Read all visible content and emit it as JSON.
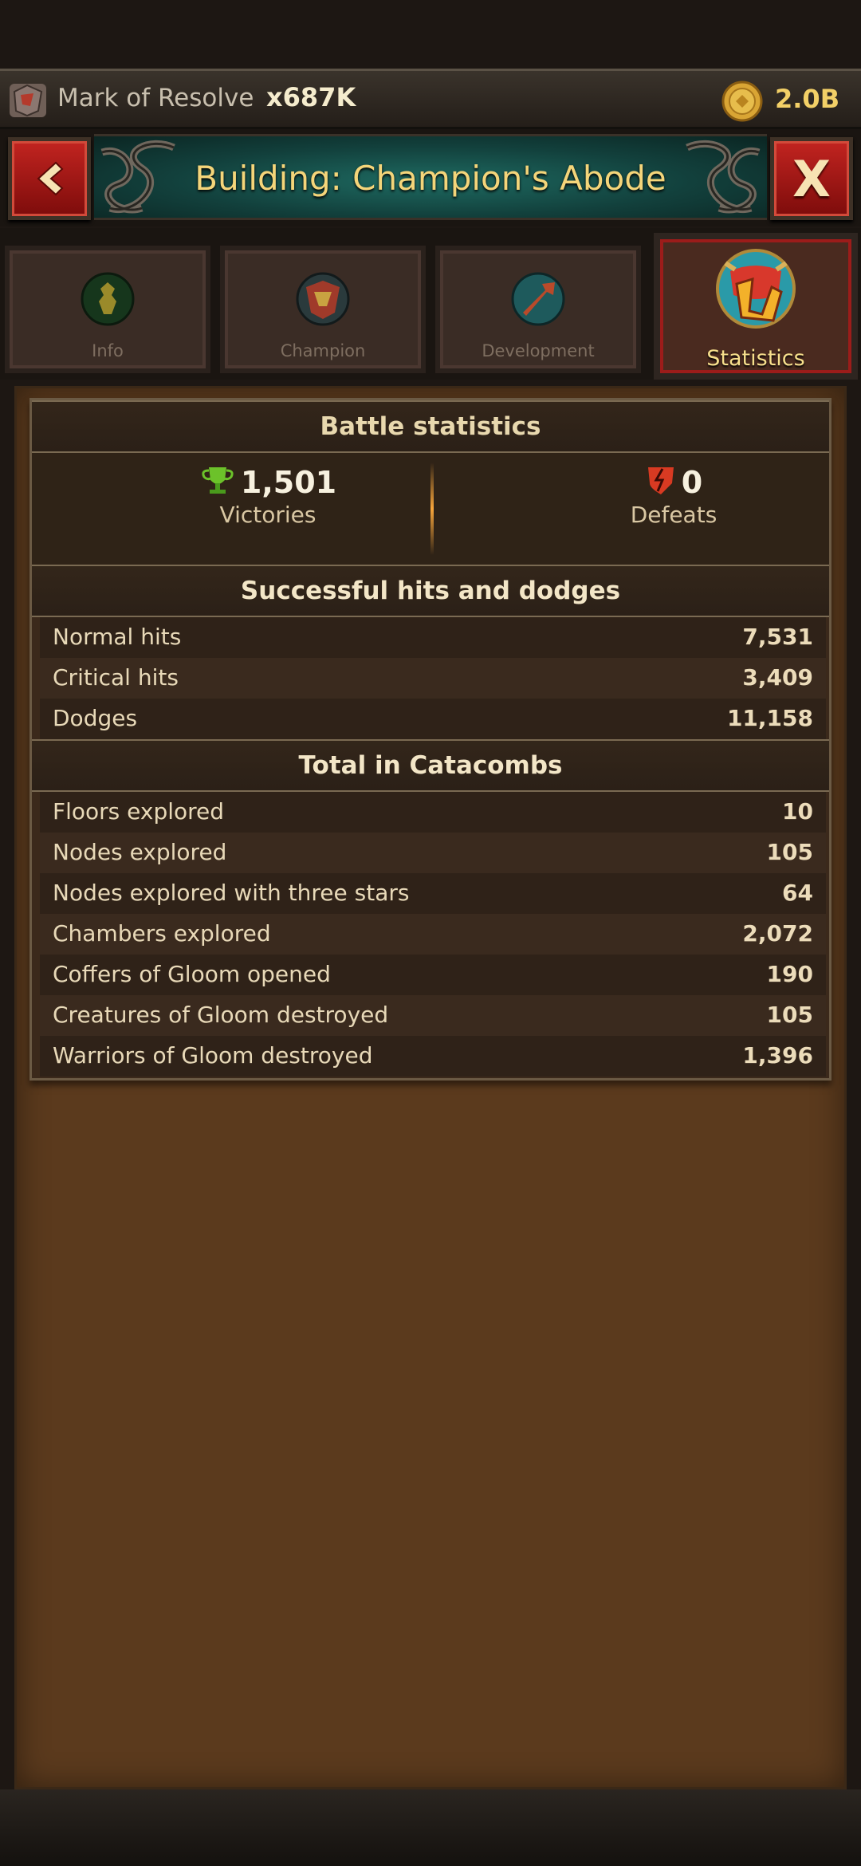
{
  "resource_bar": {
    "resource_name": "Mark of Resolve",
    "resource_count": "x687K",
    "gold_amount": "2.0B"
  },
  "title_bar": {
    "title": "Building: Champion's Abode",
    "close_label": "X"
  },
  "tabs": [
    {
      "label": "Info",
      "icon": "info-icon"
    },
    {
      "label": "Champion",
      "icon": "champion-icon"
    },
    {
      "label": "Development",
      "icon": "development-icon"
    },
    {
      "label": "Statistics",
      "icon": "statistics-icon",
      "active": true
    }
  ],
  "battle": {
    "heading": "Battle statistics",
    "victories_count": "1,501",
    "victories_label": "Victories",
    "defeats_count": "0",
    "defeats_label": "Defeats"
  },
  "hits": {
    "heading": "Successful hits and dodges",
    "rows": [
      {
        "label": "Normal hits",
        "value": "7,531"
      },
      {
        "label": "Critical hits",
        "value": "3,409"
      },
      {
        "label": "Dodges",
        "value": "11,158"
      }
    ]
  },
  "catacombs": {
    "heading": "Total in Catacombs",
    "rows": [
      {
        "label": "Floors explored",
        "value": "10"
      },
      {
        "label": "Nodes explored",
        "value": "105"
      },
      {
        "label": "Nodes explored with three stars",
        "value": "64"
      },
      {
        "label": "Chambers explored",
        "value": "2,072"
      },
      {
        "label": "Coffers of Gloom opened",
        "value": "190"
      },
      {
        "label": "Creatures of Gloom destroyed",
        "value": "105"
      },
      {
        "label": "Warriors of Gloom destroyed",
        "value": "1,396"
      }
    ]
  },
  "colors": {
    "accent_gold": "#f4d57a",
    "button_red": "#c22420",
    "title_teal": "#1e6a61"
  }
}
